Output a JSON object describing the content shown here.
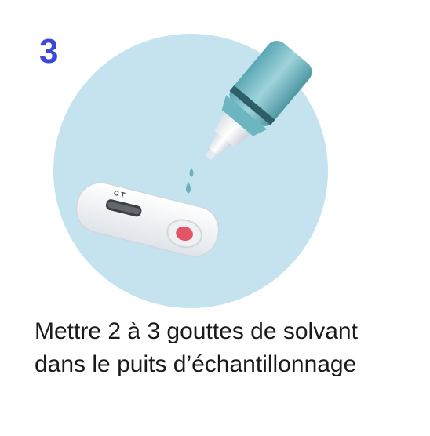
{
  "step": {
    "number": "3"
  },
  "illustration": {
    "circle_color": "#c5e3ee",
    "bottle_color": "#7fc1cc",
    "bottle_band_color": "#2e5f66",
    "drop_color": "#6ab0bd",
    "well_color": "#e15567",
    "cassette_color": "#f4f6f8"
  },
  "caption": {
    "line1": "Mettre 2 à 3 gouttes de solvant",
    "line2": "dans le puits d’échantillonnage"
  },
  "colors": {
    "step_number": "#3b48d8",
    "text": "#1a1a1a"
  }
}
